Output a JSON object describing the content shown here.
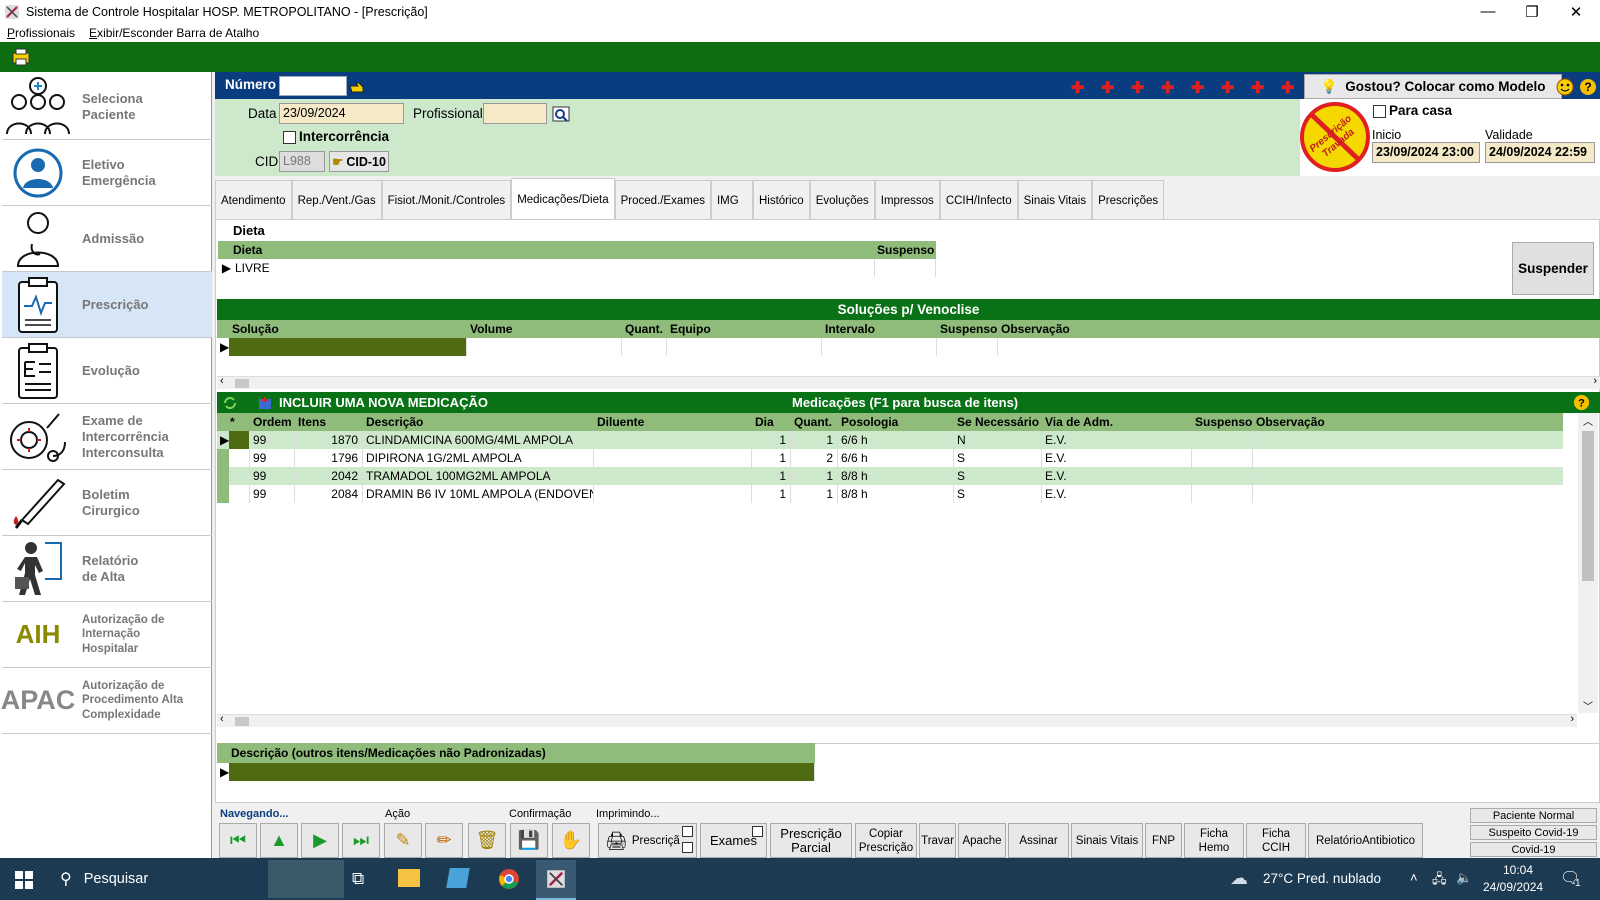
{
  "window": {
    "title": "Sistema de Controle Hospitalar HOSP. METROPOLITANO - [Prescrição]",
    "minimize": "—",
    "restore": "❐",
    "close": "✕"
  },
  "menu": {
    "items": [
      "Profissionais",
      "Exibir/Esconder Barra de Atalho"
    ]
  },
  "sidebar": {
    "items": [
      {
        "label": "Seleciona Paciente",
        "icon": "users-icon"
      },
      {
        "label": "Eletivo Emergência",
        "icon": "doctor-circle-icon"
      },
      {
        "label": "Admissão",
        "icon": "doctor-icon"
      },
      {
        "label": "Prescrição",
        "icon": "clipboard-pulse-icon"
      },
      {
        "label": "Evolução",
        "icon": "clipboard-text-icon"
      },
      {
        "label": "Exame de Intercorrência Interconsulta",
        "icon": "stethoscope-icon"
      },
      {
        "label": "Boletim Cirurgico",
        "icon": "scalpel-icon"
      },
      {
        "label": "Relatório de Alta",
        "icon": "walking-man-icon"
      },
      {
        "label": "Autorização de Internação Hospitalar",
        "abbr": "AIH"
      },
      {
        "label": "Autorização de Procedimento Alta Complexidade",
        "abbr": "APAC"
      }
    ]
  },
  "header": {
    "numero_label": "Número",
    "numero_value": "",
    "model_button": "Gostou? Colocar como Modelo",
    "data_label": "Data",
    "data_value": "23/09/2024",
    "profissional_label": "Profissional",
    "profissional_value": "",
    "intercorrencia_label": "Intercorrência",
    "cid_label": "CID",
    "cid_value": "L988",
    "cid_button": "CID-10",
    "stamp_text": "Prescrição Travada",
    "para_casa_label": "Para casa",
    "inicio_label": "Inicio",
    "inicio_value": "23/09/2024 23:00",
    "validade_label": "Validade",
    "validade_value": "24/09/2024 22:59"
  },
  "tabs": [
    "Atendimento",
    "Rep./Vent./Gas",
    "Fisiot./Monit./Controles",
    "Medicações/Dieta",
    "Proced./Exames",
    "IMG",
    "Histórico",
    "Evoluções",
    "Impressos",
    "CCIH/Infecto",
    "Sinais Vitais",
    "Prescrições"
  ],
  "dieta": {
    "group_label": "Dieta",
    "col_dieta": "Dieta",
    "col_suspenso": "Suspenso",
    "rows": [
      {
        "dieta": "LIVRE",
        "suspenso": ""
      }
    ],
    "suspender_button": "Suspender"
  },
  "solucoes": {
    "title": "Soluções p/ Venoclise",
    "columns": [
      "Solução",
      "Volume",
      "Quant.",
      "Equipo",
      "Intervalo",
      "Suspenso",
      "Observação"
    ]
  },
  "medicacoes": {
    "include_label": "INCLUIR UMA NOVA MEDICAÇÃO",
    "title": "Medicações (F1 para busca de itens)",
    "columns": [
      "*",
      "Ordem",
      "Itens",
      "Descrição",
      "Diluente",
      "Dia",
      "Quant.",
      "Posologia",
      "Se Necessário",
      "Via  de Adm.",
      "Suspenso",
      "Observação"
    ],
    "rows": [
      {
        "ordem": "99",
        "itens": "1870",
        "descricao": "CLINDAMICINA 600MG/4ML AMPOLA",
        "diluente": "",
        "dia": "1",
        "quant": "1",
        "posologia": "6/6 h",
        "se_necessario": "N",
        "via": "E.V.",
        "suspenso": "",
        "observacao": ""
      },
      {
        "ordem": "99",
        "itens": "1796",
        "descricao": "DIPIRONA 1G/2ML AMPOLA",
        "diluente": "",
        "dia": "1",
        "quant": "2",
        "posologia": "6/6 h",
        "se_necessario": "S",
        "via": "E.V.",
        "suspenso": "",
        "observacao": ""
      },
      {
        "ordem": "99",
        "itens": "2042",
        "descricao": "TRAMADOL 100MG2ML AMPOLA",
        "diluente": "",
        "dia": "1",
        "quant": "1",
        "posologia": "8/8 h",
        "se_necessario": "S",
        "via": "E.V.",
        "suspenso": "",
        "observacao": ""
      },
      {
        "ordem": "99",
        "itens": "2084",
        "descricao": "DRAMIN B6 IV 10ML AMPOLA (ENDOVENO",
        "diluente": "",
        "dia": "1",
        "quant": "1",
        "posologia": "8/8 h",
        "se_necessario": "S",
        "via": "E.V.",
        "suspenso": "",
        "observacao": ""
      }
    ]
  },
  "descricao": {
    "header": "Descrição (outros itens/Medicações não Padronizadas)"
  },
  "bottom": {
    "navegando": "Navegando...",
    "acao": "Ação",
    "confirmacao": "Confirmação",
    "imprimindo": "Imprimindo...",
    "buttons": [
      "Prescriçã",
      "Exames",
      "Prescrição Parcial",
      "Copiar Prescrição",
      "Travar",
      "Apache",
      "Assinar",
      "Sinais Vitais",
      "FNP",
      "Ficha Hemo",
      "Ficha CCIH",
      "RelatórioAntibiotico"
    ],
    "status": [
      "Paciente Normal",
      "Suspeito Covid-19",
      "Covid-19"
    ]
  },
  "taskbar": {
    "search": "Pesquisar",
    "weather": "27°C  Pred. nublado",
    "time": "10:04",
    "date": "24/09/2024",
    "notifications": "1"
  },
  "colors": {
    "green_dark": "#0a7216",
    "green_grid_header": "#8fbc7a",
    "green_panel": "#cde8cb",
    "blue_strip": "#0a3d80",
    "taskbar": "#1c3a52"
  }
}
